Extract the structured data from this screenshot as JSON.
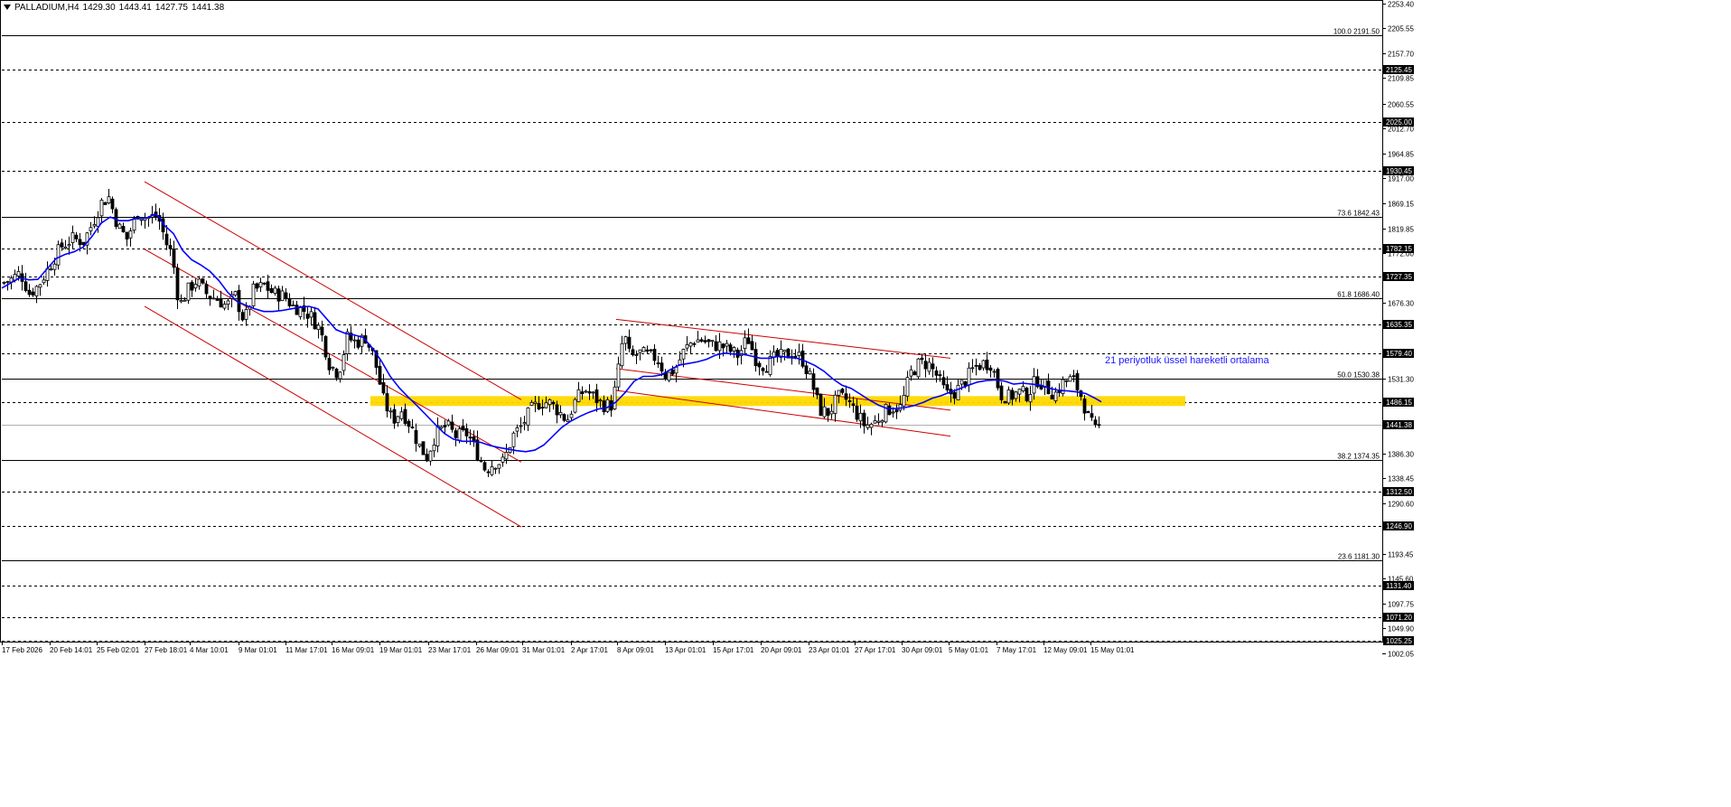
{
  "header": {
    "symbol": "PALLADIUM,H4",
    "open": "1429.30",
    "high": "1443.41",
    "low": "1427.75",
    "close": "1441.38"
  },
  "annotation": {
    "text": "21 periyotluk üssel hareketli ortalama",
    "color": "#1a1aff"
  },
  "colors": {
    "candle": "#000000",
    "ema": "#0000ff",
    "channel": "#cc0000",
    "support_zone": "#ffd800",
    "price_line": "#b0b0b0"
  },
  "chart_data": {
    "type": "candlestick",
    "symbol": "PALLADIUM",
    "timeframe": "H4",
    "ylim": [
      1000,
      2260
    ],
    "y_ticks": [
      "2253.40",
      "2205.55",
      "2157.70",
      "2109.85",
      "2060.55",
      "2012.70",
      "1964.85",
      "1917.00",
      "1869.15",
      "1819.85",
      "1772.00",
      "1676.30",
      "1531.30",
      "1386.30",
      "1338.45",
      "1290.60",
      "1193.45",
      "1145.60",
      "1097.75",
      "1049.90",
      "1002.05"
    ],
    "x_ticks": [
      "17 Feb 2026",
      "20 Feb 14:01",
      "25 Feb 02:01",
      "27 Feb 18:01",
      "4 Mar 10:01",
      "9 Mar 01:01",
      "11 Mar 17:01",
      "16 Mar 09:01",
      "19 Mar 01:01",
      "23 Mar 17:01",
      "26 Mar 09:01",
      "31 Mar 01:01",
      "2 Apr 17:01",
      "8 Apr 09:01",
      "13 Apr 01:01",
      "15 Apr 17:01",
      "20 Apr 09:01",
      "23 Apr 01:01",
      "27 Apr 17:01",
      "30 Apr 09:01",
      "5 May 01:01",
      "7 May 17:01",
      "12 May 09:01",
      "15 May 01:01"
    ],
    "horizontal_levels": [
      {
        "price": 2125.45,
        "label": "2125.45",
        "style": "dashed"
      },
      {
        "price": 2025.0,
        "label": "2025.00",
        "style": "dashed"
      },
      {
        "price": 1930.45,
        "label": "1930.45",
        "style": "dashed"
      },
      {
        "price": 1782.15,
        "label": "1782.15",
        "style": "dashed"
      },
      {
        "price": 1727.35,
        "label": "1727.35",
        "style": "dashed"
      },
      {
        "price": 1635.35,
        "label": "1635.35",
        "style": "dashed"
      },
      {
        "price": 1579.4,
        "label": "1579.40",
        "style": "dashed"
      },
      {
        "price": 1486.15,
        "label": "1486.15",
        "style": "dashed"
      },
      {
        "price": 1312.5,
        "label": "1312.50",
        "style": "dashed"
      },
      {
        "price": 1246.9,
        "label": "1246.90",
        "style": "dashed"
      },
      {
        "price": 1131.4,
        "label": "1131.40",
        "style": "dashed"
      },
      {
        "price": 1071.2,
        "label": "1071.20",
        "style": "dashed"
      },
      {
        "price": 1025.25,
        "label": "1025.25",
        "style": "dashed"
      }
    ],
    "fibonacci": [
      {
        "level": "100.0",
        "price": 2191.5,
        "label": "100.0 2191.50"
      },
      {
        "level": "73.6",
        "price": 1842.43,
        "label": "73.6 1842.43"
      },
      {
        "level": "61.8",
        "price": 1686.4,
        "label": "61.8 1686.40"
      },
      {
        "level": "50.0",
        "price": 1530.38,
        "label": "50.0 1530.38"
      },
      {
        "level": "38.2",
        "price": 1374.35,
        "label": "38.2 1374.35"
      },
      {
        "level": "23.6",
        "price": 1181.3,
        "label": "23.6 1181.30"
      }
    ],
    "current_price": {
      "price": 1441.38,
      "label": "1441.38"
    },
    "support_zone": {
      "from_date": "19 Mar 01:01",
      "to_date": "18 May 01:01",
      "low": 1478,
      "high": 1497
    },
    "indicators": [
      {
        "name": "EMA",
        "period": 21,
        "points": [
          [
            0,
            1705
          ],
          [
            10,
            1715
          ],
          [
            20,
            1725
          ],
          [
            30,
            1721
          ],
          [
            40,
            1722
          ],
          [
            50,
            1742
          ],
          [
            60,
            1762
          ],
          [
            70,
            1770
          ],
          [
            80,
            1775
          ],
          [
            90,
            1784
          ],
          [
            100,
            1805
          ],
          [
            110,
            1830
          ],
          [
            120,
            1842
          ],
          [
            130,
            1835
          ],
          [
            140,
            1835
          ],
          [
            150,
            1840
          ],
          [
            160,
            1840
          ],
          [
            170,
            1848
          ],
          [
            175,
            1840
          ],
          [
            180,
            1826
          ],
          [
            190,
            1810
          ],
          [
            200,
            1778
          ],
          [
            210,
            1760
          ],
          [
            220,
            1750
          ],
          [
            230,
            1738
          ],
          [
            240,
            1720
          ],
          [
            250,
            1697
          ],
          [
            260,
            1680
          ],
          [
            270,
            1672
          ],
          [
            280,
            1665
          ],
          [
            290,
            1660
          ],
          [
            300,
            1660
          ],
          [
            310,
            1662
          ],
          [
            320,
            1665
          ],
          [
            330,
            1668
          ],
          [
            340,
            1670
          ],
          [
            350,
            1665
          ],
          [
            360,
            1645
          ],
          [
            370,
            1625
          ],
          [
            380,
            1618
          ],
          [
            390,
            1615
          ],
          [
            400,
            1610
          ],
          [
            410,
            1590
          ],
          [
            420,
            1565
          ],
          [
            430,
            1535
          ],
          [
            440,
            1513
          ],
          [
            450,
            1495
          ],
          [
            460,
            1478
          ],
          [
            470,
            1460
          ],
          [
            480,
            1442
          ],
          [
            490,
            1425
          ],
          [
            500,
            1414
          ],
          [
            510,
            1410
          ],
          [
            520,
            1410
          ],
          [
            530,
            1408
          ],
          [
            540,
            1402
          ],
          [
            550,
            1398
          ],
          [
            560,
            1395
          ],
          [
            570,
            1392
          ],
          [
            580,
            1390
          ],
          [
            590,
            1393
          ],
          [
            600,
            1403
          ],
          [
            610,
            1420
          ],
          [
            620,
            1437
          ],
          [
            630,
            1449
          ],
          [
            640,
            1458
          ],
          [
            650,
            1466
          ],
          [
            660,
            1472
          ],
          [
            670,
            1475
          ],
          [
            680,
            1486
          ],
          [
            690,
            1504
          ],
          [
            700,
            1526
          ],
          [
            710,
            1535
          ],
          [
            720,
            1535
          ],
          [
            730,
            1538
          ],
          [
            740,
            1548
          ],
          [
            750,
            1557
          ],
          [
            760,
            1560
          ],
          [
            770,
            1563
          ],
          [
            780,
            1568
          ],
          [
            790,
            1576
          ],
          [
            800,
            1580
          ],
          [
            810,
            1578
          ],
          [
            820,
            1578
          ],
          [
            830,
            1574
          ],
          [
            840,
            1570
          ],
          [
            850,
            1570
          ],
          [
            860,
            1574
          ],
          [
            870,
            1572
          ],
          [
            880,
            1570
          ],
          [
            890,
            1564
          ],
          [
            900,
            1556
          ],
          [
            910,
            1545
          ],
          [
            920,
            1530
          ],
          [
            930,
            1518
          ],
          [
            940,
            1512
          ],
          [
            950,
            1501
          ],
          [
            960,
            1490
          ],
          [
            970,
            1480
          ],
          [
            980,
            1473
          ],
          [
            990,
            1473
          ],
          [
            1000,
            1475
          ],
          [
            1010,
            1479
          ],
          [
            1020,
            1485
          ],
          [
            1030,
            1493
          ],
          [
            1040,
            1498
          ],
          [
            1050,
            1505
          ],
          [
            1060,
            1511
          ],
          [
            1070,
            1518
          ],
          [
            1080,
            1524
          ],
          [
            1090,
            1527
          ],
          [
            1100,
            1528
          ],
          [
            1110,
            1526
          ],
          [
            1120,
            1520
          ],
          [
            1130,
            1522
          ],
          [
            1140,
            1520
          ],
          [
            1150,
            1518
          ],
          [
            1160,
            1512
          ],
          [
            1170,
            1508
          ],
          [
            1180,
            1507
          ],
          [
            1190,
            1505
          ],
          [
            1200,
            1502
          ],
          [
            1210,
            1493
          ],
          [
            1217,
            1486
          ]
        ]
      }
    ],
    "trendlines": [
      {
        "name": "descending-channel-1-upper",
        "p1": [
          158,
          1910
        ],
        "p2": [
          575,
          1490
        ]
      },
      {
        "name": "descending-channel-1-middle",
        "p1": [
          158,
          1780
        ],
        "p2": [
          575,
          1370
        ]
      },
      {
        "name": "descending-channel-1-lower",
        "p1": [
          158,
          1670
        ],
        "p2": [
          575,
          1245
        ]
      },
      {
        "name": "descending-channel-2-upper",
        "p1": [
          680,
          1645
        ],
        "p2": [
          1050,
          1570
        ]
      },
      {
        "name": "descending-channel-2-middle",
        "p1": [
          680,
          1550
        ],
        "p2": [
          1050,
          1470
        ]
      },
      {
        "name": "descending-channel-2-lower",
        "p1": [
          680,
          1508
        ],
        "p2": [
          1050,
          1420
        ]
      }
    ],
    "candles_waypoints": [
      [
        0,
        1715
      ],
      [
        10,
        1722
      ],
      [
        20,
        1735
      ],
      [
        30,
        1695
      ],
      [
        40,
        1710
      ],
      [
        55,
        1755
      ],
      [
        65,
        1785
      ],
      [
        78,
        1800
      ],
      [
        90,
        1795
      ],
      [
        100,
        1830
      ],
      [
        110,
        1870
      ],
      [
        118,
        1880
      ],
      [
        128,
        1825
      ],
      [
        138,
        1800
      ],
      [
        150,
        1850
      ],
      [
        160,
        1840
      ],
      [
        172,
        1845
      ],
      [
        182,
        1790
      ],
      [
        188,
        1770
      ],
      [
        196,
        1670
      ],
      [
        205,
        1700
      ],
      [
        215,
        1720
      ],
      [
        228,
        1690
      ],
      [
        238,
        1685
      ],
      [
        248,
        1670
      ],
      [
        258,
        1690
      ],
      [
        268,
        1640
      ],
      [
        278,
        1700
      ],
      [
        290,
        1710
      ],
      [
        300,
        1695
      ],
      [
        312,
        1690
      ],
      [
        322,
        1670
      ],
      [
        332,
        1665
      ],
      [
        342,
        1650
      ],
      [
        352,
        1625
      ],
      [
        362,
        1560
      ],
      [
        372,
        1540
      ],
      [
        382,
        1610
      ],
      [
        392,
        1600
      ],
      [
        402,
        1610
      ],
      [
        412,
        1570
      ],
      [
        422,
        1490
      ],
      [
        432,
        1450
      ],
      [
        442,
        1470
      ],
      [
        452,
        1440
      ],
      [
        462,
        1400
      ],
      [
        470,
        1380
      ],
      [
        480,
        1425
      ],
      [
        492,
        1440
      ],
      [
        502,
        1420
      ],
      [
        515,
        1425
      ],
      [
        525,
        1390
      ],
      [
        535,
        1355
      ],
      [
        545,
        1370
      ],
      [
        555,
        1370
      ],
      [
        565,
        1420
      ],
      [
        575,
        1440
      ],
      [
        585,
        1470
      ],
      [
        595,
        1485
      ],
      [
        605,
        1485
      ],
      [
        615,
        1470
      ],
      [
        625,
        1450
      ],
      [
        635,
        1490
      ],
      [
        645,
        1510
      ],
      [
        655,
        1495
      ],
      [
        665,
        1480
      ],
      [
        675,
        1480
      ],
      [
        680,
        1525
      ],
      [
        688,
        1620
      ],
      [
        695,
        1570
      ],
      [
        705,
        1580
      ],
      [
        715,
        1575
      ],
      [
        725,
        1570
      ],
      [
        735,
        1535
      ],
      [
        745,
        1550
      ],
      [
        755,
        1585
      ],
      [
        765,
        1605
      ],
      [
        775,
        1605
      ],
      [
        785,
        1595
      ],
      [
        795,
        1595
      ],
      [
        805,
        1585
      ],
      [
        815,
        1575
      ],
      [
        825,
        1610
      ],
      [
        835,
        1565
      ],
      [
        845,
        1555
      ],
      [
        855,
        1570
      ],
      [
        865,
        1575
      ],
      [
        875,
        1580
      ],
      [
        885,
        1570
      ],
      [
        895,
        1530
      ],
      [
        905,
        1470
      ],
      [
        915,
        1465
      ],
      [
        925,
        1495
      ],
      [
        935,
        1490
      ],
      [
        945,
        1465
      ],
      [
        955,
        1440
      ],
      [
        965,
        1445
      ],
      [
        975,
        1465
      ],
      [
        985,
        1475
      ],
      [
        995,
        1475
      ],
      [
        1005,
        1540
      ],
      [
        1015,
        1560
      ],
      [
        1025,
        1560
      ],
      [
        1035,
        1535
      ],
      [
        1045,
        1500
      ],
      [
        1055,
        1505
      ],
      [
        1065,
        1525
      ],
      [
        1075,
        1550
      ],
      [
        1085,
        1560
      ],
      [
        1095,
        1560
      ],
      [
        1105,
        1500
      ],
      [
        1115,
        1495
      ],
      [
        1125,
        1505
      ],
      [
        1135,
        1500
      ],
      [
        1145,
        1530
      ],
      [
        1155,
        1515
      ],
      [
        1165,
        1500
      ],
      [
        1175,
        1525
      ],
      [
        1185,
        1530
      ],
      [
        1195,
        1495
      ],
      [
        1202,
        1455
      ],
      [
        1210,
        1430
      ],
      [
        1217,
        1441
      ]
    ]
  }
}
